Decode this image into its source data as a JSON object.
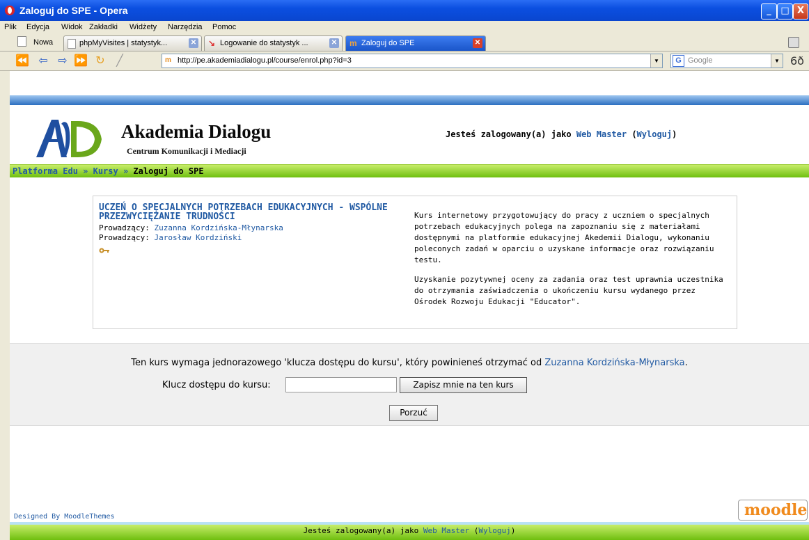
{
  "window": {
    "title": "Zaloguj do SPE - Opera",
    "minimize": "_",
    "maximize": "□",
    "close": "X"
  },
  "menu": [
    "Plik",
    "Edycja",
    "Widok",
    "Zakładki",
    "Widżety",
    "Narzędzia",
    "Pomoc"
  ],
  "tabs": [
    {
      "label": "Nowa"
    },
    {
      "label": "phpMyVisites | statystyk..."
    },
    {
      "label": "Logowanie do statystyk ..."
    },
    {
      "label": "Zaloguj do SPE"
    }
  ],
  "address": {
    "url": "http://pe.akademiadialogu.pl/course/enrol.php?id=3",
    "favicon": "m"
  },
  "search": {
    "engine_letter": "G",
    "placeholder": "Google"
  },
  "logo": {
    "name": "Akademia Dialogu",
    "subtitle": "Centrum Komunikacji i Mediacji"
  },
  "login_info": {
    "prefix": "Jesteś zalogowany(a) jako ",
    "user": "Web Master",
    "open_paren": " (",
    "logout": "Wyloguj",
    "close_paren": ")"
  },
  "breadcrumb": {
    "home": "Platforma Edu",
    "sep": " » ",
    "courses": "Kursy",
    "current": "Zaloguj do SPE"
  },
  "course": {
    "title": "UCZEŃ O SPECJALNYCH POTRZEBACH EDUKACYJNYCH - WSPÓLNE PRZEZWYCIĘŻANIE TRUDNOŚCI",
    "teacher_label": "Prowadzący: ",
    "teachers": [
      "Zuzanna Kordzińska-Młynarska",
      "Jarosław Kordziński"
    ],
    "summary": [
      "Kurs internetowy przygotowujący do pracy z uczniem o specjalnych potrzebach edukacyjnych polega na zapoznaniu się z materiałami dostępnymi na platformie edukacyjnej Akedemii Dialogu, wykonaniu poleconych zadań w oparciu o uzyskane informacje oraz rozwiązaniu testu.",
      "Uzyskanie pozytywnej oceny za zadania oraz test uprawnia uczestnika do otrzymania zaświadczenia o ukończeniu kursu wydanego przez Ośrodek Rozwoju Edukacji \"Educator\"."
    ]
  },
  "enrol": {
    "message": "Ten kurs wymaga jednorazowego 'klucza dostępu do kursu', który powinieneś otrzymać od ",
    "teacher": "Zuzanna Kordzińska-Młynarska",
    "period": ".",
    "key_label": "Klucz dostępu do kursu:",
    "key_value": "",
    "enrol_button": "Zapisz mnie na ten kurs",
    "cancel_button": "Porzuć"
  },
  "footer": {
    "designed_by": "Designed By MoodleThemes",
    "moodle_logo": "moodle",
    "prefix": "Jesteś zalogowany(a) jako ",
    "user": "Web Master",
    "open_paren": " (",
    "logout": "Wyloguj",
    "close_paren": ")"
  },
  "colors": {
    "link": "#215aa3",
    "green_bar": "#6fbf0f",
    "blue_bar": "#2b6fc0",
    "title_bar": "#0b4fe0"
  }
}
